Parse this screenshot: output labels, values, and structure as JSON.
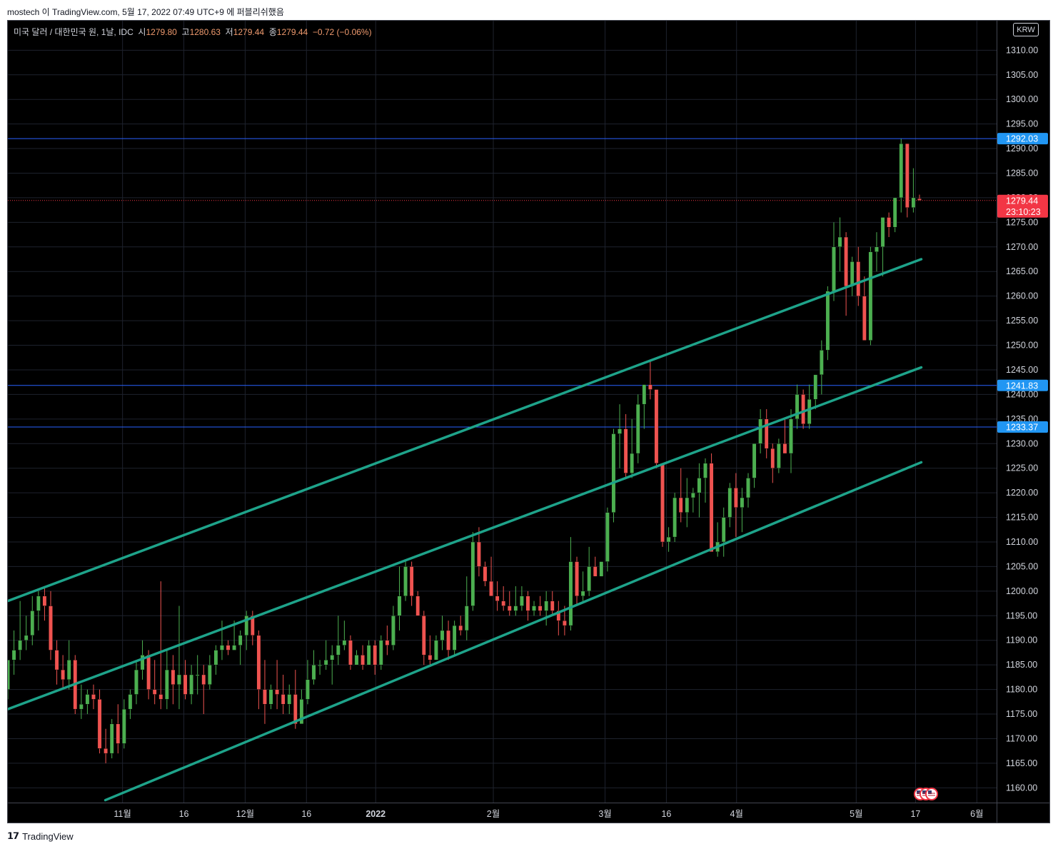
{
  "caption": "mostech 이 TradingView.com, 5월 17, 2022 07:49 UTC+9 에 퍼블리쉬했음",
  "legend": {
    "symbol": "미국 달러 / 대한민국 원, 1날, IDC",
    "open_label": "시",
    "open": "1279.80",
    "high_label": "고",
    "high": "1280.63",
    "low_label": "저",
    "low": "1279.44",
    "close_label": "종",
    "close": "1279.44",
    "change": "−0.72 (−0.06%)"
  },
  "currency_badge": "KRW",
  "footer_brand": "TradingView",
  "colors": {
    "background": "#000000",
    "up": "#4caf50",
    "down": "#ef5350",
    "channel": "#1ea38a",
    "hline": "#2962ff",
    "label_blue": "#2196f3",
    "label_red": "#f23645",
    "axis_text": "#d1d4dc",
    "grid": "#1e222d"
  },
  "chart_data": {
    "type": "candlestick",
    "ylim": [
      1157,
      1316
    ],
    "price_ticks": [
      1160,
      1165,
      1170,
      1175,
      1180,
      1185,
      1190,
      1195,
      1200,
      1205,
      1210,
      1215,
      1220,
      1225,
      1230,
      1235,
      1240,
      1245,
      1250,
      1255,
      1260,
      1265,
      1270,
      1275,
      1280,
      1285,
      1290,
      1295,
      1300,
      1305,
      1310
    ],
    "time_labels": [
      {
        "label": "11월",
        "x": 0.116,
        "bold": false
      },
      {
        "label": "16",
        "x": 0.178,
        "bold": false
      },
      {
        "label": "12월",
        "x": 0.24,
        "bold": false
      },
      {
        "label": "16",
        "x": 0.302,
        "bold": false
      },
      {
        "label": "2022",
        "x": 0.372,
        "bold": true
      },
      {
        "label": "2월",
        "x": 0.491,
        "bold": false
      },
      {
        "label": "3월",
        "x": 0.604,
        "bold": false
      },
      {
        "label": "16",
        "x": 0.666,
        "bold": false
      },
      {
        "label": "4월",
        "x": 0.737,
        "bold": false
      },
      {
        "label": "5월",
        "x": 0.858,
        "bold": false
      },
      {
        "label": "17",
        "x": 0.918,
        "bold": false
      },
      {
        "label": "6월",
        "x": 0.98,
        "bold": false
      }
    ],
    "candles_start": 0.0,
    "candles_end": 0.922,
    "candles": [
      [
        1180,
        1186,
        1178,
        1186
      ],
      [
        1186,
        1192,
        1183,
        1188
      ],
      [
        1188,
        1198,
        1186,
        1190
      ],
      [
        1190,
        1195,
        1188,
        1191
      ],
      [
        1191,
        1199,
        1189,
        1196
      ],
      [
        1196,
        1200,
        1192,
        1199
      ],
      [
        1199,
        1201,
        1194,
        1197
      ],
      [
        1197,
        1200,
        1186,
        1188
      ],
      [
        1188,
        1190,
        1181,
        1184
      ],
      [
        1184,
        1187,
        1180,
        1182
      ],
      [
        1182,
        1190,
        1180,
        1186
      ],
      [
        1186,
        1187,
        1175,
        1176
      ],
      [
        1176,
        1181,
        1174,
        1177
      ],
      [
        1177,
        1180,
        1175,
        1179
      ],
      [
        1179,
        1181,
        1176,
        1178
      ],
      [
        1178,
        1180,
        1167,
        1168
      ],
      [
        1168,
        1172,
        1165,
        1167
      ],
      [
        1167,
        1174,
        1166,
        1173
      ],
      [
        1173,
        1177,
        1167,
        1169
      ],
      [
        1169,
        1178,
        1168,
        1176
      ],
      [
        1176,
        1180,
        1174,
        1179
      ],
      [
        1179,
        1186,
        1177,
        1184
      ],
      [
        1184,
        1190,
        1182,
        1187
      ],
      [
        1187,
        1188,
        1178,
        1180
      ],
      [
        1180,
        1186,
        1177,
        1179
      ],
      [
        1179,
        1202,
        1176,
        1178
      ],
      [
        1178,
        1188,
        1176,
        1184
      ],
      [
        1184,
        1187,
        1177,
        1181
      ],
      [
        1181,
        1197,
        1176,
        1183
      ],
      [
        1183,
        1186,
        1178,
        1179
      ],
      [
        1179,
        1185,
        1177,
        1183
      ],
      [
        1183,
        1187,
        1179,
        1183
      ],
      [
        1183,
        1185,
        1175,
        1181
      ],
      [
        1181,
        1187,
        1180,
        1185
      ],
      [
        1185,
        1189,
        1183,
        1188
      ],
      [
        1188,
        1194,
        1186,
        1189
      ],
      [
        1189,
        1190,
        1187,
        1188
      ],
      [
        1188,
        1194,
        1188,
        1189
      ],
      [
        1189,
        1192,
        1185,
        1191
      ],
      [
        1191,
        1196,
        1188,
        1195
      ],
      [
        1195,
        1196,
        1189,
        1191
      ],
      [
        1191,
        1192,
        1176,
        1180
      ],
      [
        1180,
        1186,
        1173,
        1177
      ],
      [
        1177,
        1181,
        1176,
        1180
      ],
      [
        1180,
        1186,
        1176,
        1179
      ],
      [
        1179,
        1183,
        1175,
        1177
      ],
      [
        1177,
        1181,
        1175,
        1179
      ],
      [
        1179,
        1184,
        1172,
        1173
      ],
      [
        1173,
        1180,
        1173,
        1178
      ],
      [
        1178,
        1186,
        1177,
        1182
      ],
      [
        1182,
        1188,
        1181,
        1185
      ],
      [
        1185,
        1186,
        1183,
        1185
      ],
      [
        1185,
        1190,
        1184,
        1186
      ],
      [
        1186,
        1189,
        1181,
        1187
      ],
      [
        1187,
        1195,
        1185,
        1189
      ],
      [
        1189,
        1194,
        1188,
        1190
      ],
      [
        1190,
        1191,
        1184,
        1185
      ],
      [
        1185,
        1188,
        1185,
        1187
      ],
      [
        1187,
        1189,
        1184,
        1185
      ],
      [
        1185,
        1190,
        1185,
        1189
      ],
      [
        1189,
        1190,
        1183,
        1185
      ],
      [
        1185,
        1191,
        1184,
        1190
      ],
      [
        1190,
        1193,
        1187,
        1189
      ],
      [
        1189,
        1197,
        1188,
        1195
      ],
      [
        1195,
        1205,
        1192,
        1199
      ],
      [
        1199,
        1206,
        1198,
        1205
      ],
      [
        1205,
        1206,
        1197,
        1199
      ],
      [
        1199,
        1200,
        1195,
        1195
      ],
      [
        1195,
        1196,
        1185,
        1187
      ],
      [
        1187,
        1191,
        1185,
        1186
      ],
      [
        1186,
        1191,
        1186,
        1190
      ],
      [
        1190,
        1195,
        1188,
        1192
      ],
      [
        1192,
        1194,
        1186,
        1188
      ],
      [
        1188,
        1194,
        1187,
        1193
      ],
      [
        1193,
        1195,
        1191,
        1192
      ],
      [
        1192,
        1203,
        1190,
        1197
      ],
      [
        1197,
        1212,
        1196,
        1210
      ],
      [
        1210,
        1213,
        1203,
        1205
      ],
      [
        1205,
        1206,
        1201,
        1202
      ],
      [
        1202,
        1207,
        1199,
        1199
      ],
      [
        1199,
        1202,
        1196,
        1198
      ],
      [
        1198,
        1201,
        1196,
        1197
      ],
      [
        1197,
        1200,
        1195,
        1196
      ],
      [
        1196,
        1201,
        1195,
        1197
      ],
      [
        1197,
        1201,
        1196,
        1199
      ],
      [
        1199,
        1200,
        1194,
        1196
      ],
      [
        1196,
        1198,
        1195,
        1197
      ],
      [
        1197,
        1199,
        1195,
        1196
      ],
      [
        1196,
        1200,
        1193,
        1198
      ],
      [
        1198,
        1200,
        1195,
        1196
      ],
      [
        1196,
        1198,
        1191,
        1194
      ],
      [
        1194,
        1197,
        1191,
        1193
      ],
      [
        1193,
        1211,
        1192,
        1206
      ],
      [
        1206,
        1207,
        1197,
        1199
      ],
      [
        1199,
        1204,
        1198,
        1200
      ],
      [
        1200,
        1209,
        1199,
        1205
      ],
      [
        1205,
        1207,
        1203,
        1203
      ],
      [
        1203,
        1206,
        1203,
        1206
      ],
      [
        1206,
        1217,
        1204,
        1216
      ],
      [
        1216,
        1233,
        1214,
        1232
      ],
      [
        1232,
        1238,
        1225,
        1233
      ],
      [
        1233,
        1236,
        1223,
        1224
      ],
      [
        1224,
        1235,
        1223,
        1228
      ],
      [
        1228,
        1240,
        1226,
        1238
      ],
      [
        1238,
        1242,
        1233,
        1242
      ],
      [
        1242,
        1247,
        1239,
        1241
      ],
      [
        1241,
        1241,
        1225,
        1226
      ],
      [
        1226,
        1226,
        1209,
        1210
      ],
      [
        1210,
        1213,
        1208,
        1211
      ],
      [
        1211,
        1220,
        1210,
        1219
      ],
      [
        1219,
        1225,
        1214,
        1216
      ],
      [
        1216,
        1223,
        1213,
        1219
      ],
      [
        1219,
        1221,
        1216,
        1220
      ],
      [
        1220,
        1226,
        1215,
        1223
      ],
      [
        1223,
        1227,
        1218,
        1226
      ],
      [
        1226,
        1228,
        1209,
        1208
      ],
      [
        1208,
        1214,
        1207,
        1210
      ],
      [
        1210,
        1217,
        1207,
        1215
      ],
      [
        1215,
        1222,
        1213,
        1221
      ],
      [
        1221,
        1224,
        1211,
        1217
      ],
      [
        1217,
        1221,
        1212,
        1219
      ],
      [
        1219,
        1224,
        1217,
        1223
      ],
      [
        1223,
        1230,
        1221,
        1230
      ],
      [
        1230,
        1237,
        1228,
        1235
      ],
      [
        1235,
        1237,
        1227,
        1229
      ],
      [
        1229,
        1230,
        1222,
        1225
      ],
      [
        1225,
        1231,
        1224,
        1230
      ],
      [
        1230,
        1235,
        1228,
        1228
      ],
      [
        1228,
        1237,
        1224,
        1235
      ],
      [
        1235,
        1242,
        1233,
        1240
      ],
      [
        1240,
        1241,
        1233,
        1234
      ],
      [
        1234,
        1242,
        1233,
        1239
      ],
      [
        1239,
        1244,
        1237,
        1244
      ],
      [
        1244,
        1251,
        1240,
        1249
      ],
      [
        1249,
        1262,
        1247,
        1261
      ],
      [
        1261,
        1275,
        1259,
        1270
      ],
      [
        1270,
        1276,
        1265,
        1272
      ],
      [
        1272,
        1273,
        1256,
        1262
      ],
      [
        1262,
        1268,
        1260,
        1267
      ],
      [
        1267,
        1270,
        1258,
        1260
      ],
      [
        1260,
        1264,
        1252,
        1251
      ],
      [
        1251,
        1270,
        1250,
        1269
      ],
      [
        1269,
        1273,
        1265,
        1270
      ],
      [
        1270,
        1276,
        1264,
        1276
      ],
      [
        1276,
        1277,
        1272,
        1274
      ],
      [
        1274,
        1280,
        1273,
        1280
      ],
      [
        1280,
        1292,
        1277,
        1291
      ],
      [
        1291,
        1291,
        1276,
        1278
      ],
      [
        1278,
        1286,
        1277,
        1280
      ],
      [
        1279.8,
        1280.63,
        1279.44,
        1279.44
      ]
    ],
    "channel_lines": [
      {
        "p1": [
          0.0,
          1198.0
        ],
        "p2": [
          0.9238,
          1267.5
        ]
      },
      {
        "p1": [
          0.0,
          1176.0
        ],
        "p2": [
          0.9238,
          1245.5
        ]
      },
      {
        "p1": [
          0.0986,
          1157.5
        ],
        "p2": [
          0.9238,
          1226.2
        ]
      }
    ],
    "horizontal_levels": [
      1292.03,
      1241.83,
      1233.37
    ],
    "current_price": 1279.44,
    "price_labels": [
      {
        "value": 1292.03,
        "text": "1292.03",
        "color": "#2196f3"
      },
      {
        "value": 1241.83,
        "text": "1241.83",
        "color": "#2196f3"
      },
      {
        "value": 1233.37,
        "text": "1233.37",
        "color": "#2196f3"
      }
    ],
    "current_label": {
      "price": "1279.44",
      "countdown": "23:10:23"
    },
    "partial_tick": "1",
    "last_price_stub": "1280.00"
  }
}
